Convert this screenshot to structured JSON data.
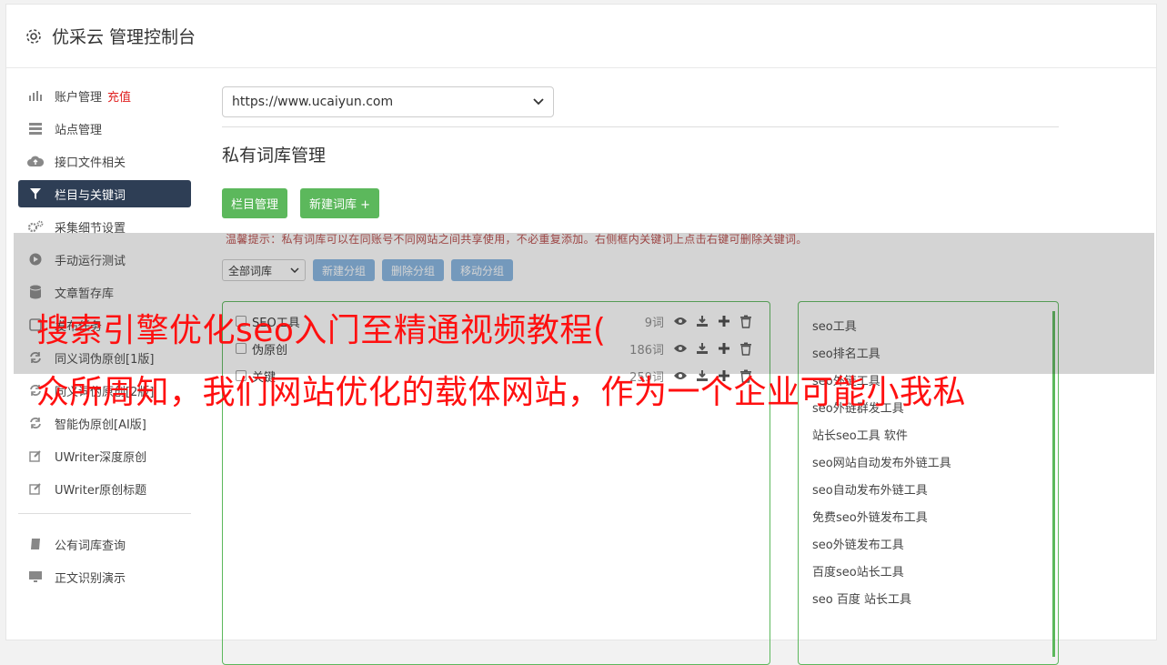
{
  "header": {
    "title": "优采云 管理控制台"
  },
  "sidebar": {
    "items": [
      {
        "label": "账户管理",
        "badge": "充值",
        "icon": "bar-chart-icon"
      },
      {
        "label": "站点管理",
        "icon": "server-icon"
      },
      {
        "label": "接口文件相关",
        "icon": "cloud-upload-icon"
      },
      {
        "label": "栏目与关键词",
        "icon": "filter-icon",
        "active": true
      },
      {
        "label": "采集细节设置",
        "icon": "gears-icon"
      },
      {
        "label": "手动运行测试",
        "icon": "play-icon"
      },
      {
        "label": "文章暂存库",
        "icon": "database-icon"
      },
      {
        "label": "发布任务",
        "icon": "task-icon"
      },
      {
        "label": "同义词伪原创[1版]",
        "icon": "refresh-icon"
      },
      {
        "label": "同义词伪原创[2版]",
        "icon": "refresh-icon"
      },
      {
        "label": "智能伪原创[AI版]",
        "icon": "refresh-icon"
      },
      {
        "label": "UWriter深度原创",
        "icon": "edit-icon"
      },
      {
        "label": "UWriter原创标题",
        "icon": "edit-icon"
      }
    ],
    "items2": [
      {
        "label": "公有词库查询",
        "icon": "book-icon"
      },
      {
        "label": "正文识别演示",
        "icon": "monitor-icon"
      }
    ]
  },
  "main": {
    "site_select": "https://www.ucaiyun.com",
    "section_title": "私有词库管理",
    "btn_columns": "栏目管理",
    "btn_new_lib": "新建词库 +",
    "tip": "温馨提示：私有词库可以在同账号不同网站之间共享使用，不必重复添加。右侧框内关键词上点击右键可删除关键词。",
    "lib_filter": "全部词库",
    "btn_new_group": "新建分组",
    "btn_delete_group": "删除分组",
    "btn_move_group": "移动分组",
    "libraries": [
      {
        "name": "SEO工具",
        "count": "9词"
      },
      {
        "name": "伪原创",
        "count": "186词"
      },
      {
        "name": "关键",
        "count": "259词"
      }
    ],
    "keywords": [
      "seo工具",
      "seo排名工具",
      "seo外链工具",
      "seo外链群发工具",
      "站长seo工具 软件",
      "seo网站自动发布外链工具",
      "seo自动发布外链工具",
      "免费seo外链发布工具",
      "seo外链发布工具",
      "百度seo站长工具",
      "seo 百度 站长工具"
    ]
  },
  "overlay": {
    "line1": "搜索引擎优化seo入门至精通视频教程(",
    "line2": "众所周知，我们网站优化的载体网站，作为一个企业可能小我私"
  }
}
